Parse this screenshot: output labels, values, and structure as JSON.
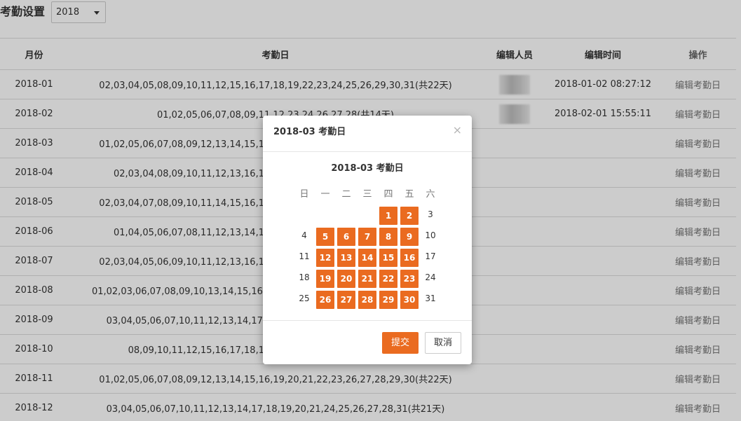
{
  "header": {
    "title": "考勤设置",
    "year_value": "2018"
  },
  "table": {
    "columns": [
      "月份",
      "考勤日",
      "编辑人员",
      "编辑时间",
      "操作"
    ],
    "rows": [
      {
        "month": "2018-01",
        "days": "02,03,04,05,08,09,10,11,12,15,16,17,18,19,22,23,24,25,26,29,30,31(共22天)",
        "editor_blurred": true,
        "time": "2018-01-02 08:27:12",
        "action": "编辑考勤日"
      },
      {
        "month": "2018-02",
        "days": "01,02,05,06,07,08,09,11,12,23,24,26,27,28(共14天)",
        "editor_blurred": true,
        "time": "2018-02-01 15:55:11",
        "action": "编辑考勤日"
      },
      {
        "month": "2018-03",
        "days": "01,02,05,06,07,08,09,12,13,14,15,16,19,20,21,22,23,26,27,28,29,30(共22天)",
        "editor_blurred": false,
        "time": "",
        "action": "编辑考勤日"
      },
      {
        "month": "2018-04",
        "days": "02,03,04,08,09,10,11,12,13,16,17,18,19,20,23,24,25,26,27,28(共20天)",
        "editor_blurred": false,
        "time": "",
        "action": "编辑考勤日"
      },
      {
        "month": "2018-05",
        "days": "02,03,04,07,08,09,10,11,14,15,16,17,18,21,22,23,24,25,28,29,30,31(共22天)",
        "editor_blurred": false,
        "time": "",
        "action": "编辑考勤日"
      },
      {
        "month": "2018-06",
        "days": "01,04,05,06,07,08,11,12,13,14,15,19,20,21,22,25,26,27,28,29(共20天)",
        "editor_blurred": false,
        "time": "",
        "action": "编辑考勤日"
      },
      {
        "month": "2018-07",
        "days": "02,03,04,05,06,09,10,11,12,13,16,17,18,19,20,23,24,25,26,27,30,31(共22天)",
        "editor_blurred": false,
        "time": "",
        "action": "编辑考勤日"
      },
      {
        "month": "2018-08",
        "days": "01,02,03,06,07,08,09,10,13,14,15,16,17,20,21,22,23,24,27,28,29,30,31(共23天)",
        "editor_blurred": false,
        "time": "",
        "action": "编辑考勤日"
      },
      {
        "month": "2018-09",
        "days": "03,04,05,06,07,10,11,12,13,14,17,18,19,20,21,25,26,27,28,29,30(共21天)",
        "editor_blurred": false,
        "time": "",
        "action": "编辑考勤日"
      },
      {
        "month": "2018-10",
        "days": "08,09,10,11,12,15,16,17,18,19,22,23,24,25,26,29,30,31(共18天)",
        "editor_blurred": false,
        "time": "",
        "action": "编辑考勤日"
      },
      {
        "month": "2018-11",
        "days": "01,02,05,06,07,08,09,12,13,14,15,16,19,20,21,22,23,26,27,28,29,30(共22天)",
        "editor_blurred": false,
        "time": "",
        "action": "编辑考勤日"
      },
      {
        "month": "2018-12",
        "days": "03,04,05,06,07,10,11,12,13,14,17,18,19,20,21,24,25,26,27,28,31(共21天)",
        "editor_blurred": false,
        "time": "",
        "action": "编辑考勤日"
      }
    ]
  },
  "modal": {
    "title": "2018-03 考勤日",
    "close_glyph": "×",
    "calendar_title": "2018-03 考勤日",
    "weekdays": [
      "日",
      "一",
      "二",
      "三",
      "四",
      "五",
      "六"
    ],
    "weeks": [
      [
        {
          "d": "",
          "sel": false
        },
        {
          "d": "",
          "sel": false
        },
        {
          "d": "",
          "sel": false
        },
        {
          "d": "",
          "sel": false
        },
        {
          "d": "1",
          "sel": true
        },
        {
          "d": "2",
          "sel": true
        },
        {
          "d": "3",
          "sel": false
        }
      ],
      [
        {
          "d": "4",
          "sel": false
        },
        {
          "d": "5",
          "sel": true
        },
        {
          "d": "6",
          "sel": true
        },
        {
          "d": "7",
          "sel": true
        },
        {
          "d": "8",
          "sel": true
        },
        {
          "d": "9",
          "sel": true
        },
        {
          "d": "10",
          "sel": false
        }
      ],
      [
        {
          "d": "11",
          "sel": false
        },
        {
          "d": "12",
          "sel": true
        },
        {
          "d": "13",
          "sel": true
        },
        {
          "d": "14",
          "sel": true
        },
        {
          "d": "15",
          "sel": true
        },
        {
          "d": "16",
          "sel": true
        },
        {
          "d": "17",
          "sel": false
        }
      ],
      [
        {
          "d": "18",
          "sel": false
        },
        {
          "d": "19",
          "sel": true
        },
        {
          "d": "20",
          "sel": true
        },
        {
          "d": "21",
          "sel": true
        },
        {
          "d": "22",
          "sel": true
        },
        {
          "d": "23",
          "sel": true
        },
        {
          "d": "24",
          "sel": false
        }
      ],
      [
        {
          "d": "25",
          "sel": false
        },
        {
          "d": "26",
          "sel": true
        },
        {
          "d": "27",
          "sel": true
        },
        {
          "d": "28",
          "sel": true
        },
        {
          "d": "29",
          "sel": true
        },
        {
          "d": "30",
          "sel": true
        },
        {
          "d": "31",
          "sel": false
        }
      ]
    ],
    "submit_label": "提交",
    "cancel_label": "取消"
  },
  "colors": {
    "accent": "#ea6b20",
    "overlay": "rgba(0,0,0,0.20)"
  }
}
